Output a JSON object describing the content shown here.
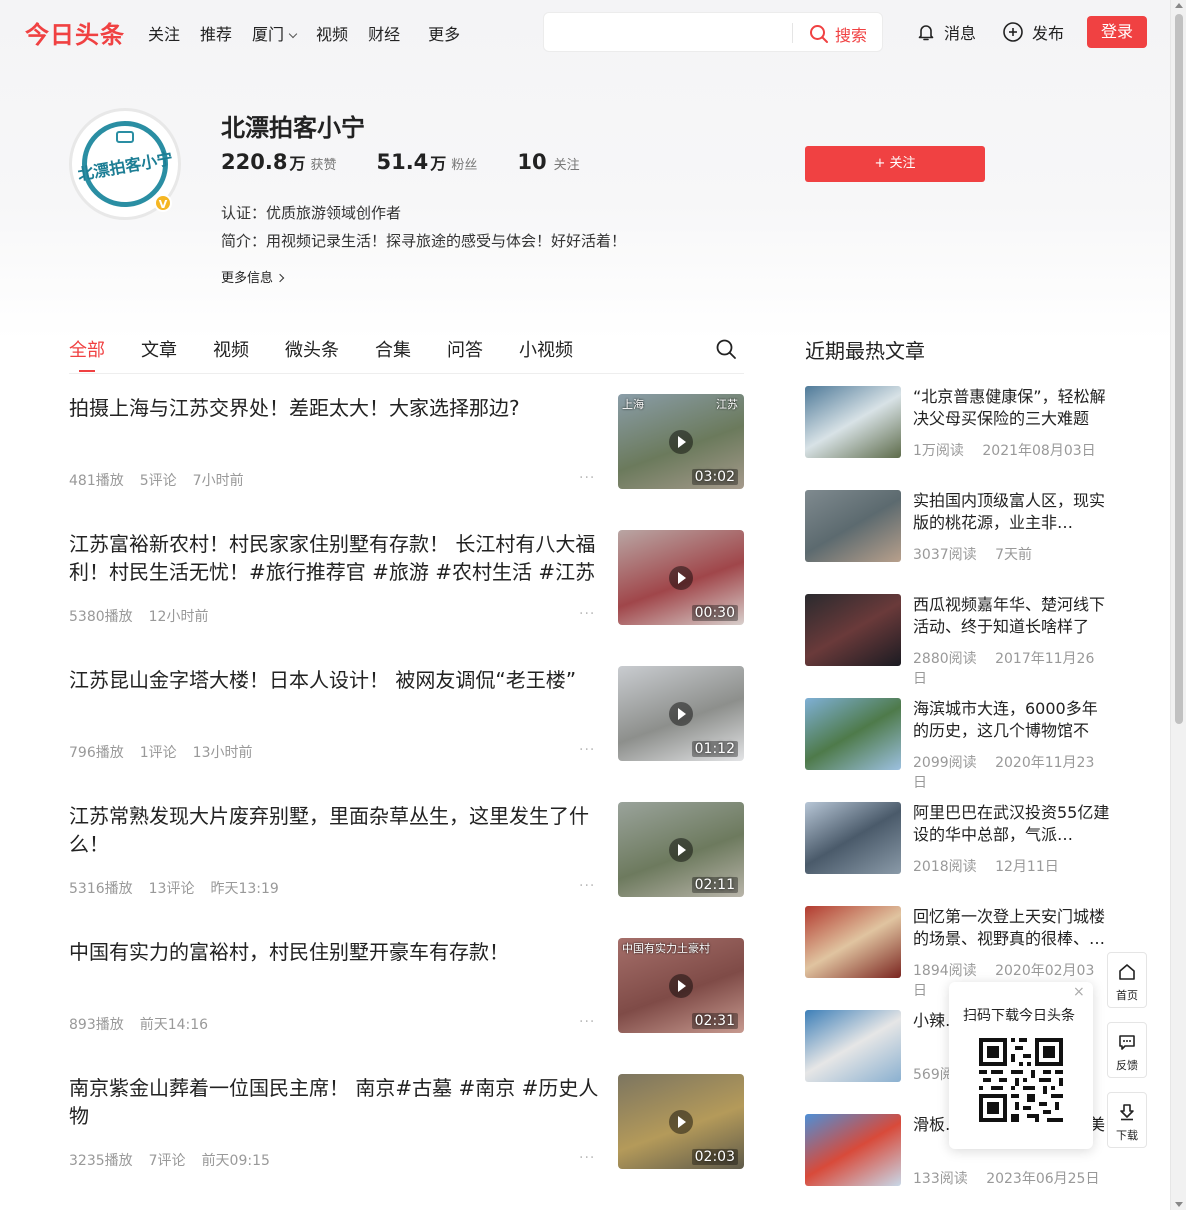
{
  "header": {
    "logo": "今日头条",
    "nav": [
      "关注",
      "推荐",
      "厦门",
      "视频",
      "财经",
      "更多"
    ],
    "search_placeholder": "",
    "search_btn": "搜索",
    "messages": "消息",
    "publish": "发布",
    "login": "登录"
  },
  "profile": {
    "avatar_text": "北漂拍客小宁",
    "verified_badge": "V",
    "name": "北漂拍客小宁",
    "stats": [
      {
        "num": "220.8",
        "unit": "万",
        "label": "获赞"
      },
      {
        "num": "51.4",
        "unit": "万",
        "label": "粉丝"
      },
      {
        "num": "10",
        "unit": "",
        "label": "关注"
      }
    ],
    "follow_btn": "+ 关注",
    "cert": "认证：优质旅游领域创作者",
    "intro": "简介：用视频记录生活！探寻旅途的感受与体会！好好活着！",
    "more_info": "更多信息"
  },
  "tabs": [
    "全部",
    "文章",
    "视频",
    "微头条",
    "合集",
    "问答",
    "小视频"
  ],
  "feed": [
    {
      "title": "拍摄上海与江苏交界处！差距太大！大家选择那边?",
      "meta": [
        "481播放",
        "5评论",
        "7小时前"
      ],
      "duration": "03:02",
      "overlay_left": "上海",
      "overlay_right": "江苏",
      "colors": [
        "#8a9da8",
        "#6b7a5c",
        "#a59a8c"
      ]
    },
    {
      "title": "江苏富裕新农村！村民家家住别墅有存款！ 长江村有八大福利！村民生活无忧！#旅行推荐官 #旅游 #农村生活 #江苏",
      "meta": [
        "5380播放",
        "12小时前"
      ],
      "duration": "00:30",
      "overlay_left": "",
      "overlay_right": "",
      "colors": [
        "#b9a6a4",
        "#a0464a",
        "#d8cfcc"
      ]
    },
    {
      "title": "江苏昆山金字塔大楼！日本人设计！ 被网友调侃“老王楼”",
      "meta": [
        "796播放",
        "1评论",
        "13小时前"
      ],
      "duration": "01:12",
      "overlay_left": "",
      "overlay_right": "",
      "colors": [
        "#c9ccd0",
        "#8d8f8c",
        "#e3e4e6"
      ]
    },
    {
      "title": "江苏常熟发现大片废弃别墅，里面杂草丛生，这里发生了什么！",
      "meta": [
        "5316播放",
        "13评论",
        "昨天13:19"
      ],
      "duration": "02:11",
      "overlay_left": "",
      "overlay_right": "",
      "colors": [
        "#9aa39b",
        "#6d7a5e",
        "#b9b5aa"
      ]
    },
    {
      "title": "中国有实力的富裕村，村民住别墅开豪车有存款！",
      "meta": [
        "893播放",
        "前天14:16"
      ],
      "duration": "02:31",
      "overlay_left": "中国有实力土豪村",
      "overlay_right": "",
      "colors": [
        "#a56f6a",
        "#7f4b47",
        "#c79a90"
      ]
    },
    {
      "title": "南京紫金山葬着一位国民主席！ 南京#古墓 #南京 #历史人物",
      "meta": [
        "3235播放",
        "7评论",
        "前天09:15"
      ],
      "duration": "02:03",
      "overlay_left": "",
      "overlay_right": "",
      "colors": [
        "#7c7560",
        "#b49a5a",
        "#5e5a4a"
      ]
    }
  ],
  "sidebar": {
    "title": "近期最热文章",
    "items": [
      {
        "title": "“北京普惠健康保”，轻松解决父母买保险的三大难题",
        "reads": "1万阅读",
        "date": "2021年08月03日",
        "colors": [
          "#4f7a99",
          "#d8e2e6",
          "#5d6b4a"
        ]
      },
      {
        "title": "实拍国内顶级富人区，现实版的桃花源，业主非…",
        "reads": "3037阅读",
        "date": "7天前",
        "colors": [
          "#7f8a8f",
          "#5c6a6f",
          "#b8a08c"
        ]
      },
      {
        "title": "西瓜视频嘉年华、楚河线下活动、终于知道长啥样了",
        "reads": "2880阅读",
        "date": "2017年11月26日",
        "colors": [
          "#2a2a2e",
          "#6a3a3a",
          "#1b1b22"
        ]
      },
      {
        "title": "海滨城市大连，6000多年的历史，这几个博物馆不能…",
        "reads": "2099阅读",
        "date": "2020年11月23日",
        "colors": [
          "#7fb0d6",
          "#4e7a4a",
          "#9cc0e0"
        ]
      },
      {
        "title": "阿里巴巴在武汉投资55亿建设的华中总部，气派…",
        "reads": "2018阅读",
        "date": "12月11日",
        "colors": [
          "#b7c6d6",
          "#4a5a6a",
          "#8a9aa8"
        ]
      },
      {
        "title": "回忆第一次登上天安门城楼的场景、视野真的很棒、…",
        "reads": "1894阅读",
        "date": "2020年02月03日",
        "colors": [
          "#b23a2f",
          "#e0c4a0",
          "#7a2520"
        ]
      },
      {
        "title": "小辣…作伴…",
        "reads": "569阅…",
        "date": "",
        "colors": [
          "#3d7fb8",
          "#e6e6e6",
          "#8ab0d0"
        ]
      },
      {
        "title": "滑板…角镜头捕捉独特的美",
        "reads": "133阅读",
        "date": "2023年06月25日",
        "colors": [
          "#4e8fd6",
          "#d84a3a",
          "#c8d8e8"
        ]
      }
    ]
  },
  "qr_popup": {
    "title": "扫码下载今日头条",
    "close": "×"
  },
  "float_buttons": [
    "首页",
    "反馈",
    "下载"
  ]
}
